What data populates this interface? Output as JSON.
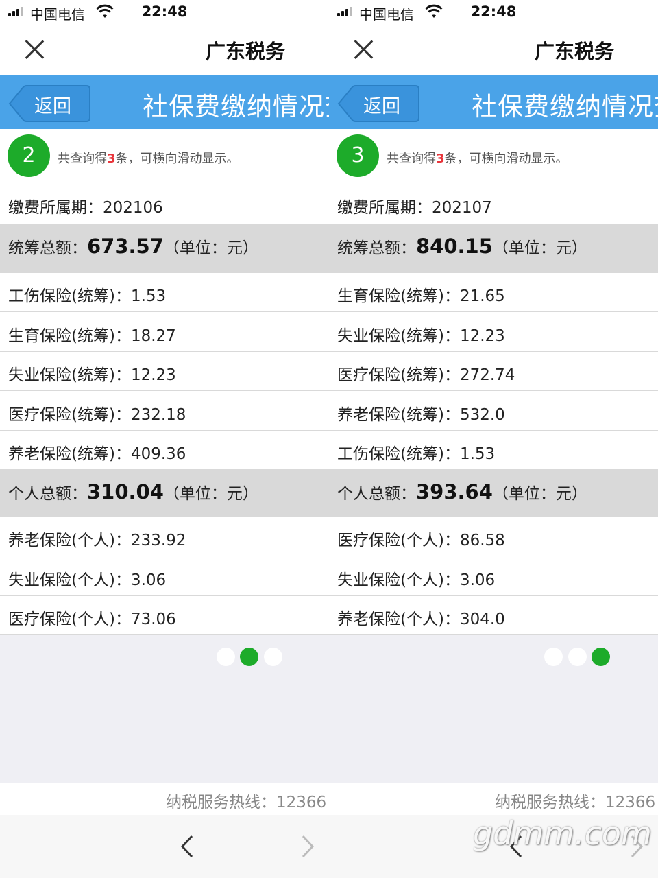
{
  "status_bar": {
    "carrier": "中国电信",
    "time": "22:48"
  },
  "nav": {
    "title": "广东税务"
  },
  "header": {
    "back_label": "返回",
    "page_title": "社保费缴纳情况查"
  },
  "panels": [
    {
      "page_number": "2",
      "summary_prefix": "共查询得",
      "summary_count": "3",
      "summary_suffix": "条，可横向滑动显示。",
      "period_label": "缴费所属期：",
      "period_value": "202106",
      "pooled_total_label": "统筹总额：",
      "pooled_total_value": "673.57",
      "pooled_total_unit": "（单位：元）",
      "pooled_items": [
        {
          "label": "工伤保险(统筹)：",
          "value": "1.53"
        },
        {
          "label": "生育保险(统筹)：",
          "value": "18.27"
        },
        {
          "label": "失业保险(统筹)：",
          "value": "12.23"
        },
        {
          "label": "医疗保险(统筹)：",
          "value": "232.18"
        },
        {
          "label": "养老保险(统筹)：",
          "value": "409.36"
        }
      ],
      "personal_total_label": "个人总额：",
      "personal_total_value": "310.04",
      "personal_total_unit": "（单位：元）",
      "personal_items": [
        {
          "label": "养老保险(个人)：",
          "value": "233.92"
        },
        {
          "label": "失业保险(个人)：",
          "value": "3.06"
        },
        {
          "label": "医疗保险(个人)：",
          "value": "73.06"
        }
      ],
      "pagination": {
        "total": 3,
        "current": 2
      }
    },
    {
      "page_number": "3",
      "summary_prefix": "共查询得",
      "summary_count": "3",
      "summary_suffix": "条，可横向滑动显示。",
      "period_label": "缴费所属期：",
      "period_value": "202107",
      "pooled_total_label": "统筹总额：",
      "pooled_total_value": "840.15",
      "pooled_total_unit": "（单位：元）",
      "pooled_items": [
        {
          "label": "生育保险(统筹)：",
          "value": "21.65"
        },
        {
          "label": "失业保险(统筹)：",
          "value": "12.23"
        },
        {
          "label": "医疗保险(统筹)：",
          "value": "272.74"
        },
        {
          "label": "养老保险(统筹)：",
          "value": "532.0"
        },
        {
          "label": "工伤保险(统筹)：",
          "value": "1.53"
        }
      ],
      "personal_total_label": "个人总额：",
      "personal_total_value": "393.64",
      "personal_total_unit": "（单位：元）",
      "personal_items": [
        {
          "label": "医疗保险(个人)：",
          "value": "86.58"
        },
        {
          "label": "失业保险(个人)：",
          "value": "3.06"
        },
        {
          "label": "养老保险(个人)：",
          "value": "304.0"
        }
      ],
      "pagination": {
        "total": 3,
        "current": 3
      }
    }
  ],
  "footer": {
    "hotline": "纳税服务热线：12366"
  },
  "watermark": "gdmm.com",
  "colors": {
    "header_blue": "#4aa3e8",
    "badge_green": "#1dab2a",
    "highlight_red": "#e8343a",
    "total_row_gray": "#d9d9d9"
  }
}
